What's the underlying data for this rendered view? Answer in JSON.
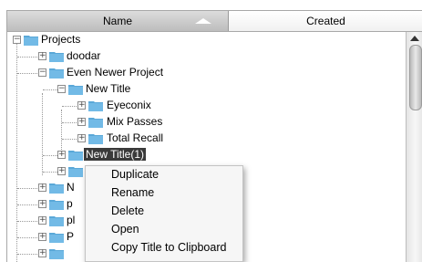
{
  "columns": {
    "name": "Name",
    "created": "Created"
  },
  "tree": [
    {
      "label": "Projects"
    },
    {
      "label": "doodar"
    },
    {
      "label": "Even Newer Project"
    },
    {
      "label": "New Title"
    },
    {
      "label": "Eyeconix"
    },
    {
      "label": "Mix Passes"
    },
    {
      "label": "Total Recall"
    },
    {
      "label": "New Title(1)"
    },
    {
      "label": ""
    },
    {
      "label": "N"
    },
    {
      "label": "p"
    },
    {
      "label": "pl"
    },
    {
      "label": "P"
    },
    {
      "label": ""
    }
  ],
  "context_menu": {
    "items": [
      "Duplicate",
      "Rename",
      "Delete",
      "Open",
      "Copy Title to Clipboard"
    ]
  },
  "colors": {
    "folder": "#5aa8d8",
    "selection": "#3a3a3a",
    "menu_bg": "#f6f6f6"
  },
  "icons": {
    "folder": "folder-icon",
    "expand": "plus-expander-icon",
    "collapse": "minus-expander-icon"
  }
}
